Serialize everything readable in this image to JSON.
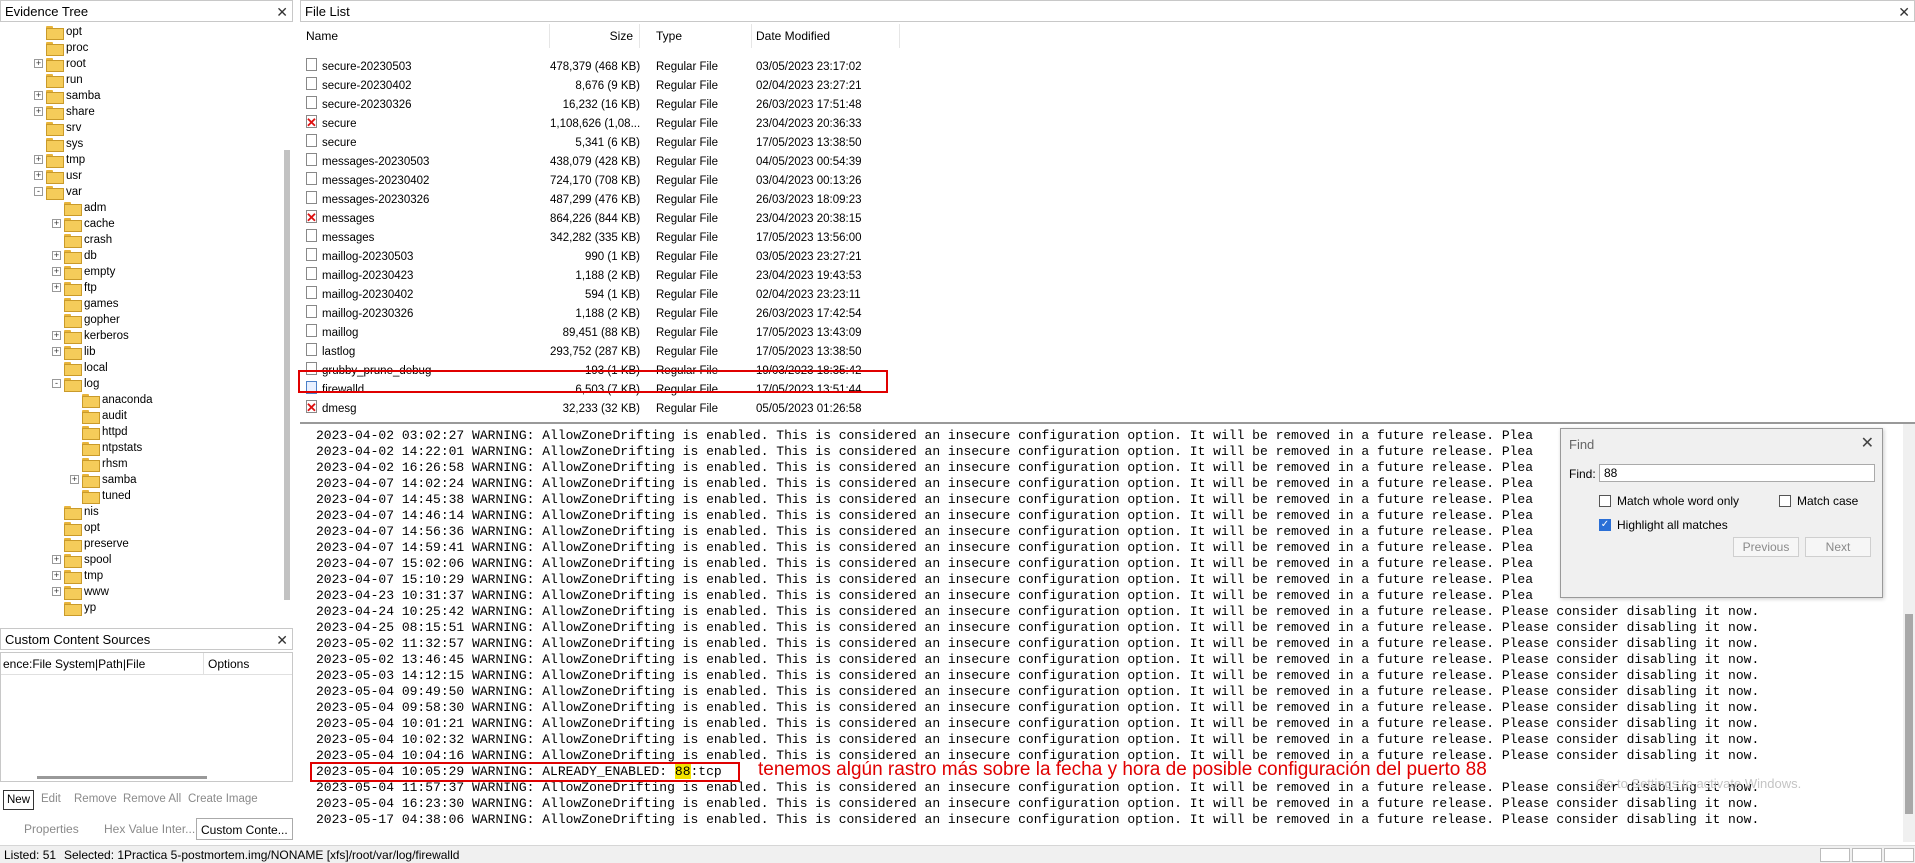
{
  "evidence_tree": {
    "title": "Evidence Tree",
    "items": [
      {
        "label": "opt",
        "level": 1,
        "expander": ""
      },
      {
        "label": "proc",
        "level": 1,
        "expander": ""
      },
      {
        "label": "root",
        "level": 1,
        "expander": "+"
      },
      {
        "label": "run",
        "level": 1,
        "expander": ""
      },
      {
        "label": "samba",
        "level": 1,
        "expander": "+"
      },
      {
        "label": "share",
        "level": 1,
        "expander": "+"
      },
      {
        "label": "srv",
        "level": 1,
        "expander": ""
      },
      {
        "label": "sys",
        "level": 1,
        "expander": ""
      },
      {
        "label": "tmp",
        "level": 1,
        "expander": "+"
      },
      {
        "label": "usr",
        "level": 1,
        "expander": "+"
      },
      {
        "label": "var",
        "level": 1,
        "expander": "-"
      },
      {
        "label": "adm",
        "level": 2,
        "expander": ""
      },
      {
        "label": "cache",
        "level": 2,
        "expander": "+"
      },
      {
        "label": "crash",
        "level": 2,
        "expander": ""
      },
      {
        "label": "db",
        "level": 2,
        "expander": "+"
      },
      {
        "label": "empty",
        "level": 2,
        "expander": "+"
      },
      {
        "label": "ftp",
        "level": 2,
        "expander": "+"
      },
      {
        "label": "games",
        "level": 2,
        "expander": ""
      },
      {
        "label": "gopher",
        "level": 2,
        "expander": ""
      },
      {
        "label": "kerberos",
        "level": 2,
        "expander": "+"
      },
      {
        "label": "lib",
        "level": 2,
        "expander": "+"
      },
      {
        "label": "local",
        "level": 2,
        "expander": ""
      },
      {
        "label": "log",
        "level": 2,
        "expander": "-"
      },
      {
        "label": "anaconda",
        "level": 3,
        "expander": ""
      },
      {
        "label": "audit",
        "level": 3,
        "expander": ""
      },
      {
        "label": "httpd",
        "level": 3,
        "expander": ""
      },
      {
        "label": "ntpstats",
        "level": 3,
        "expander": ""
      },
      {
        "label": "rhsm",
        "level": 3,
        "expander": ""
      },
      {
        "label": "samba",
        "level": 3,
        "expander": "+"
      },
      {
        "label": "tuned",
        "level": 3,
        "expander": ""
      },
      {
        "label": "nis",
        "level": 2,
        "expander": ""
      },
      {
        "label": "opt",
        "level": 2,
        "expander": ""
      },
      {
        "label": "preserve",
        "level": 2,
        "expander": ""
      },
      {
        "label": "spool",
        "level": 2,
        "expander": "+"
      },
      {
        "label": "tmp",
        "level": 2,
        "expander": "+"
      },
      {
        "label": "www",
        "level": 2,
        "expander": "+"
      },
      {
        "label": "yp",
        "level": 2,
        "expander": ""
      }
    ]
  },
  "custom_content_sources": {
    "title": "Custom Content Sources",
    "col1": "ence:File System|Path|File",
    "col2": "Options",
    "buttons": [
      "New",
      "Edit",
      "Remove",
      "Remove All",
      "Create Image"
    ]
  },
  "bottom_tabs": [
    "Properties",
    "Hex Value Inter...",
    "Custom Conte..."
  ],
  "file_list": {
    "title": "File List",
    "columns": [
      "Name",
      "Size",
      "Type",
      "Date Modified"
    ],
    "rows": [
      {
        "name": "secure-20230503",
        "size": "478,379 (468 KB)",
        "type": "Regular File",
        "date": "03/05/2023 23:17:02",
        "deleted": false
      },
      {
        "name": "secure-20230402",
        "size": "8,676 (9 KB)",
        "type": "Regular File",
        "date": "02/04/2023 23:27:21",
        "deleted": false
      },
      {
        "name": "secure-20230326",
        "size": "16,232 (16 KB)",
        "type": "Regular File",
        "date": "26/03/2023 17:51:48",
        "deleted": false
      },
      {
        "name": "secure",
        "size": "1,108,626 (1,08...",
        "type": "Regular File",
        "date": "23/04/2023 20:36:33",
        "deleted": true
      },
      {
        "name": "secure",
        "size": "5,341 (6 KB)",
        "type": "Regular File",
        "date": "17/05/2023 13:38:50",
        "deleted": false
      },
      {
        "name": "messages-20230503",
        "size": "438,079 (428 KB)",
        "type": "Regular File",
        "date": "04/05/2023 00:54:39",
        "deleted": false
      },
      {
        "name": "messages-20230402",
        "size": "724,170 (708 KB)",
        "type": "Regular File",
        "date": "03/04/2023 00:13:26",
        "deleted": false
      },
      {
        "name": "messages-20230326",
        "size": "487,299 (476 KB)",
        "type": "Regular File",
        "date": "26/03/2023 18:09:23",
        "deleted": false
      },
      {
        "name": "messages",
        "size": "864,226 (844 KB)",
        "type": "Regular File",
        "date": "23/04/2023 20:38:15",
        "deleted": true
      },
      {
        "name": "messages",
        "size": "342,282 (335 KB)",
        "type": "Regular File",
        "date": "17/05/2023 13:56:00",
        "deleted": false
      },
      {
        "name": "maillog-20230503",
        "size": "990 (1 KB)",
        "type": "Regular File",
        "date": "03/05/2023 23:27:21",
        "deleted": false
      },
      {
        "name": "maillog-20230423",
        "size": "1,188 (2 KB)",
        "type": "Regular File",
        "date": "23/04/2023 19:43:53",
        "deleted": false
      },
      {
        "name": "maillog-20230402",
        "size": "594 (1 KB)",
        "type": "Regular File",
        "date": "02/04/2023 23:23:11",
        "deleted": false
      },
      {
        "name": "maillog-20230326",
        "size": "1,188 (2 KB)",
        "type": "Regular File",
        "date": "26/03/2023 17:42:54",
        "deleted": false
      },
      {
        "name": "maillog",
        "size": "89,451 (88 KB)",
        "type": "Regular File",
        "date": "17/05/2023 13:43:09",
        "deleted": false
      },
      {
        "name": "lastlog",
        "size": "293,752 (287 KB)",
        "type": "Regular File",
        "date": "17/05/2023 13:38:50",
        "deleted": false
      },
      {
        "name": "grubby_prune_debug",
        "size": "193 (1 KB)",
        "type": "Regular File",
        "date": "19/03/2023 18:35:42",
        "deleted": false
      },
      {
        "name": "firewalld",
        "size": "6,503 (7 KB)",
        "type": "Regular File",
        "date": "17/05/2023 13:51:44",
        "deleted": false,
        "selected": true
      },
      {
        "name": "dmesg",
        "size": "32,233 (32 KB)",
        "type": "Regular File",
        "date": "05/05/2023 01:26:58",
        "deleted": true
      }
    ]
  },
  "viewer": {
    "log_lines": [
      {
        "ts": "2023-04-02 03:02:27",
        "msg": "WARNING: AllowZoneDrifting is enabled. This is considered an insecure configuration option. It will be removed in a future release. Plea"
      },
      {
        "ts": "2023-04-02 14:22:01",
        "msg": "WARNING: AllowZoneDrifting is enabled. This is considered an insecure configuration option. It will be removed in a future release. Plea"
      },
      {
        "ts": "2023-04-02 16:26:58",
        "msg": "WARNING: AllowZoneDrifting is enabled. This is considered an insecure configuration option. It will be removed in a future release. Plea"
      },
      {
        "ts": "2023-04-07 14:02:24",
        "msg": "WARNING: AllowZoneDrifting is enabled. This is considered an insecure configuration option. It will be removed in a future release. Plea"
      },
      {
        "ts": "2023-04-07 14:45:38",
        "msg": "WARNING: AllowZoneDrifting is enabled. This is considered an insecure configuration option. It will be removed in a future release. Plea"
      },
      {
        "ts": "2023-04-07 14:46:14",
        "msg": "WARNING: AllowZoneDrifting is enabled. This is considered an insecure configuration option. It will be removed in a future release. Plea"
      },
      {
        "ts": "2023-04-07 14:56:36",
        "msg": "WARNING: AllowZoneDrifting is enabled. This is considered an insecure configuration option. It will be removed in a future release. Plea"
      },
      {
        "ts": "2023-04-07 14:59:41",
        "msg": "WARNING: AllowZoneDrifting is enabled. This is considered an insecure configuration option. It will be removed in a future release. Plea"
      },
      {
        "ts": "2023-04-07 15:02:06",
        "msg": "WARNING: AllowZoneDrifting is enabled. This is considered an insecure configuration option. It will be removed in a future release. Plea"
      },
      {
        "ts": "2023-04-07 15:10:29",
        "msg": "WARNING: AllowZoneDrifting is enabled. This is considered an insecure configuration option. It will be removed in a future release. Plea"
      },
      {
        "ts": "2023-04-23 10:31:37",
        "msg": "WARNING: AllowZoneDrifting is enabled. This is considered an insecure configuration option. It will be removed in a future release. Plea"
      },
      {
        "ts": "2023-04-24 10:25:42",
        "msg": "WARNING: AllowZoneDrifting is enabled. This is considered an insecure configuration option. It will be removed in a future release. Please consider disabling it now."
      },
      {
        "ts": "2023-04-25 08:15:51",
        "msg": "WARNING: AllowZoneDrifting is enabled. This is considered an insecure configuration option. It will be removed in a future release. Please consider disabling it now."
      },
      {
        "ts": "2023-05-02 11:32:57",
        "msg": "WARNING: AllowZoneDrifting is enabled. This is considered an insecure configuration option. It will be removed in a future release. Please consider disabling it now."
      },
      {
        "ts": "2023-05-02 13:46:45",
        "msg": "WARNING: AllowZoneDrifting is enabled. This is considered an insecure configuration option. It will be removed in a future release. Please consider disabling it now."
      },
      {
        "ts": "2023-05-03 14:12:15",
        "msg": "WARNING: AllowZoneDrifting is enabled. This is considered an insecure configuration option. It will be removed in a future release. Please consider disabling it now."
      },
      {
        "ts": "2023-05-04 09:49:50",
        "msg": "WARNING: AllowZoneDrifting is enabled. This is considered an insecure configuration option. It will be removed in a future release. Please consider disabling it now."
      },
      {
        "ts": "2023-05-04 09:58:30",
        "msg": "WARNING: AllowZoneDrifting is enabled. This is considered an insecure configuration option. It will be removed in a future release. Please consider disabling it now."
      },
      {
        "ts": "2023-05-04 10:01:21",
        "msg": "WARNING: AllowZoneDrifting is enabled. This is considered an insecure configuration option. It will be removed in a future release. Please consider disabling it now."
      },
      {
        "ts": "2023-05-04 10:02:32",
        "msg": "WARNING: AllowZoneDrifting is enabled. This is considered an insecure configuration option. It will be removed in a future release. Please consider disabling it now."
      },
      {
        "ts": "2023-05-04 10:04:16",
        "msg": "WARNING: AllowZoneDrifting is enabled. This is considered an insecure configuration option. It will be removed in a future release. Please consider disabling it now."
      },
      {
        "ts": "2023-05-04 10:05:29",
        "msg": "WARNING: ALREADY_ENABLED: 88:tcp",
        "highlight": "88"
      },
      {
        "ts": "2023-05-04 11:57:37",
        "msg": "WARNING: AllowZoneDrifting is enabled. This is considered an insecure configuration option. It will be removed in a future release. Please consider disabling it now."
      },
      {
        "ts": "2023-05-04 16:23:30",
        "msg": "WARNING: AllowZoneDrifting is enabled. This is considered an insecure configuration option. It will be removed in a future release. Please consider disabling it now."
      },
      {
        "ts": "2023-05-17 04:38:06",
        "msg": "WARNING: AllowZoneDrifting is enabled. This is considered an insecure configuration option. It will be removed in a future release. Please consider disabling it now."
      }
    ],
    "annotation": "tenemos algún rastro más sobre la fecha y hora de posible configuración del puerto 88",
    "watermark": "Go to Settings to activate Windows."
  },
  "find_dialog": {
    "title": "Find",
    "find_label": "Find:",
    "find_value": "88",
    "match_whole_word_label": "Match whole word only",
    "match_whole_word_checked": false,
    "match_case_label": "Match case",
    "match_case_checked": false,
    "highlight_all_label": "Highlight all matches",
    "highlight_all_checked": true,
    "previous_label": "Previous",
    "next_label": "Next"
  },
  "status_bar": {
    "listed": "Listed: 51",
    "selected": "Selected: 1",
    "path": "Practica 5-postmortem.img/NONAME [xfs]/root/var/log/firewalld"
  },
  "colors": {
    "annotation_red": "#e00000",
    "match_highlight": "#f3e300",
    "folder_yellow": "#f5cc5a"
  }
}
